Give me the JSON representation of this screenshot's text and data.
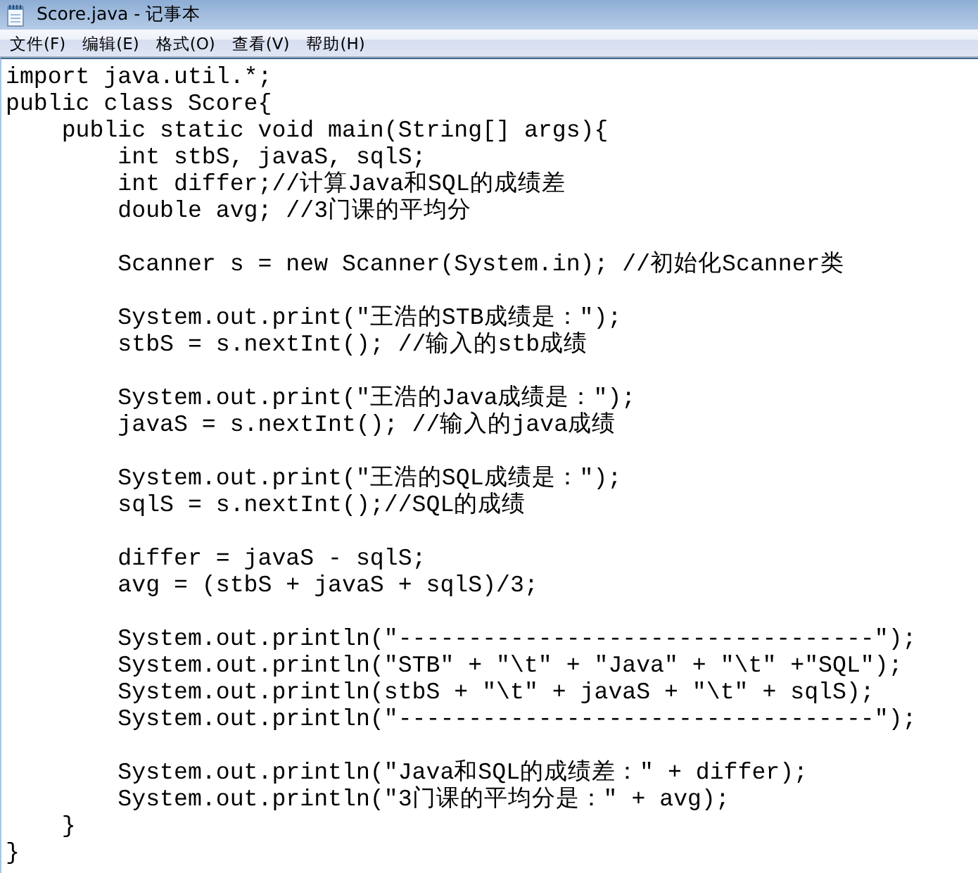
{
  "window": {
    "title": "Score.java - 记事本"
  },
  "menu_bar": [
    "文件(F)",
    "编辑(E)",
    "格式(O)",
    "查看(V)",
    "帮助(H)"
  ],
  "editor": {
    "paragraphs": [
      [
        "import java.util.*;",
        "public class Score{",
        "    public static void main(String[] args){",
        "        int stbS, javaS, sqlS;",
        "        int differ;//计算Java和SQL的成绩差",
        "        double avg; //3门课的平均分"
      ],
      [
        "        Scanner s = new Scanner(System.in); //初始化Scanner类"
      ],
      [
        "        System.out.print(\"王浩的STB成绩是：\");",
        "        stbS = s.nextInt(); //输入的stb成绩"
      ],
      [
        "        System.out.print(\"王浩的Java成绩是：\");",
        "        javaS = s.nextInt(); //输入的java成绩"
      ],
      [
        "        System.out.print(\"王浩的SQL成绩是：\");",
        "        sqlS = s.nextInt();//SQL的成绩"
      ],
      [
        "        differ = javaS - sqlS;",
        "        avg = (stbS + javaS + sqlS)/3;"
      ],
      [
        "        System.out.println(\"----------------------------------\");",
        "        System.out.println(\"STB\" + \"\\t\" + \"Java\" + \"\\t\" +\"SQL\");",
        "        System.out.println(stbS + \"\\t\" + javaS + \"\\t\" + sqlS);",
        "        System.out.println(\"----------------------------------\");"
      ],
      [
        "        System.out.println(\"Java和SQL的成绩差：\" + differ);",
        "        System.out.println(\"3门课的平均分是：\" + avg);",
        "    }",
        "}"
      ]
    ]
  }
}
